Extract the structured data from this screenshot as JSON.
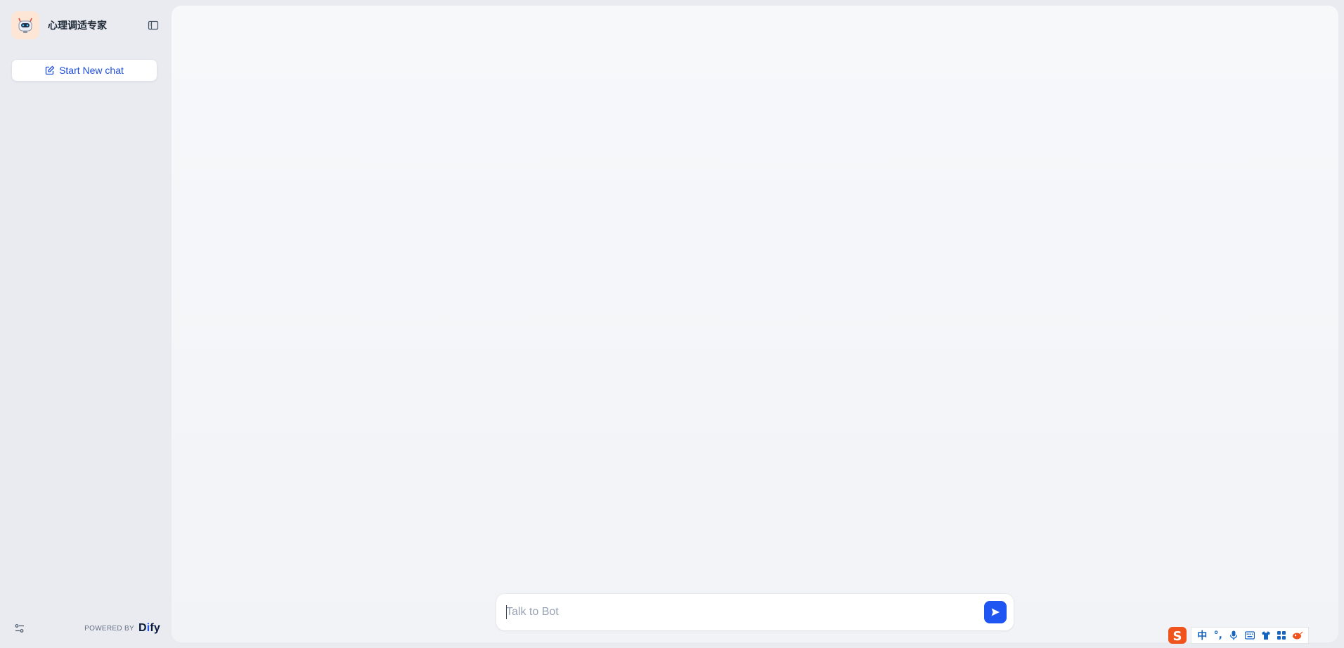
{
  "app": {
    "title": "心理调适专家",
    "logo_icon": "robot-icon"
  },
  "sidebar": {
    "new_chat_label": "Start New chat",
    "powered_by_label": "POWERED BY",
    "brand_prefix": "D",
    "brand_highlight": "i",
    "brand_suffix": "fy"
  },
  "chat": {
    "input_placeholder": "Talk to Bot"
  },
  "ime": {
    "lang_label": "中",
    "punct_label": "°,"
  },
  "colors": {
    "accent": "#1f55f0",
    "background": "#e9ebf0",
    "panel": "#f5f6f9"
  }
}
